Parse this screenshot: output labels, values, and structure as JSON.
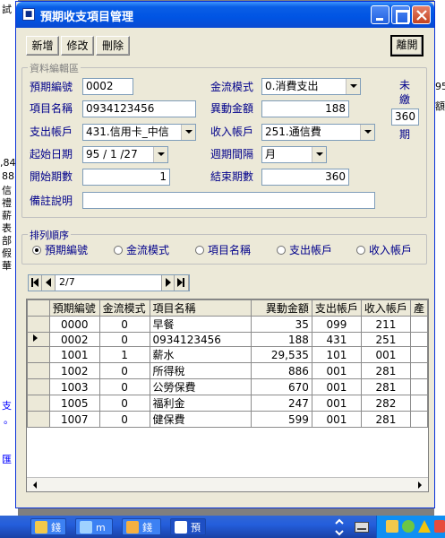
{
  "window": {
    "title": "預期收支項目管理"
  },
  "toolbar": {
    "add": "新增",
    "edit": "修改",
    "delete": "刪除",
    "close": "離開"
  },
  "edit_group": {
    "legend": "資料編輯區",
    "expected_no_label": "預期編號",
    "expected_no": "0002",
    "cashflow_label": "金流模式",
    "cashflow": "0.消費支出",
    "item_name_label": "項目名稱",
    "item_name": "0934123456",
    "amount_label": "異動金額",
    "amount": "188",
    "pay_account_label": "支出帳戶",
    "pay_account": "431.信用卡_中信",
    "income_account_label": "收入帳戶",
    "income_account": "251.通信費",
    "start_date_label": "起始日期",
    "start_date": "95 / 1 /27",
    "period_label": "週期間隔",
    "period": "月",
    "start_period_label": "開始期數",
    "start_period": "1",
    "end_period_label": "結束期數",
    "end_period": "360",
    "note_label": "備註說明",
    "note": "",
    "unpaid_1": "未",
    "unpaid_2": "繳",
    "unpaid_count": "360",
    "unpaid_3": "期"
  },
  "sort_group": {
    "legend": "排列順序",
    "options": [
      "預期編號",
      "金流模式",
      "項目名稱",
      "支出帳戶",
      "收入帳戶"
    ],
    "selected": 0
  },
  "navigator": {
    "position": "2/7"
  },
  "grid": {
    "columns": [
      "預期編號",
      "金流模式",
      "項目名稱",
      "異動金額",
      "支出帳戶",
      "收入帳戶",
      "產"
    ],
    "rows": [
      [
        "0000",
        "0",
        "早餐",
        "35",
        "099",
        "211",
        ""
      ],
      [
        "0002",
        "0",
        "0934123456",
        "188",
        "431",
        "251",
        ""
      ],
      [
        "1001",
        "1",
        "薪水",
        "29,535",
        "101",
        "001",
        ""
      ],
      [
        "1002",
        "0",
        "所得稅",
        "886",
        "001",
        "281",
        ""
      ],
      [
        "1003",
        "0",
        "公勞保費",
        "670",
        "001",
        "281",
        ""
      ],
      [
        "1005",
        "0",
        "福利金",
        "247",
        "001",
        "282",
        ""
      ],
      [
        "1007",
        "0",
        "健保費",
        "599",
        "001",
        "281",
        ""
      ]
    ],
    "current_row": 1
  },
  "taskbar": {
    "items": [
      "錢",
      "m",
      "錢",
      "預"
    ]
  },
  "background": {
    "fragments_left": [
      "試",
      ",84",
      "88",
      "信",
      "禮",
      "薪",
      "表",
      "部",
      "假",
      "華",
      "支",
      "。",
      "匯"
    ],
    "fragments_right": [
      "95",
      "額"
    ]
  },
  "colors": {
    "label": "#00008b",
    "title_bar": "#0054e3",
    "window_bg": "#ece9d8"
  }
}
